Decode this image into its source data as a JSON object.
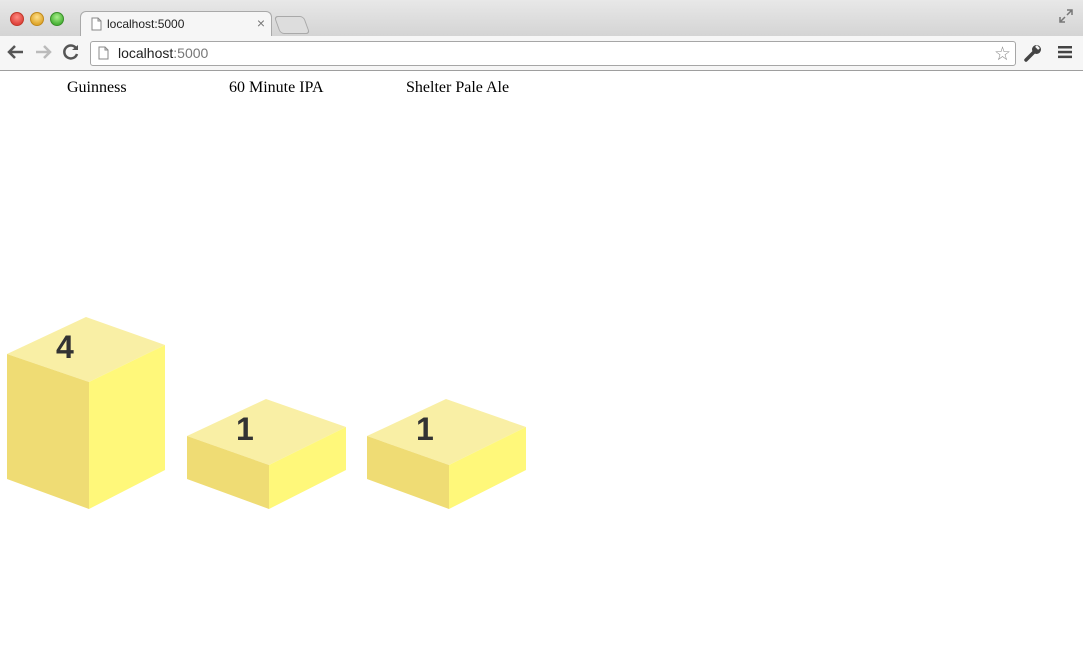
{
  "browser": {
    "tab_title": "localhost:5000",
    "tab_close": "×",
    "url_host": "localhost",
    "url_port": ":5000",
    "bookmark_star": "☆"
  },
  "beers": [
    {
      "name": "Guinness",
      "count": "4"
    },
    {
      "name": "60 Minute IPA",
      "count": "1"
    },
    {
      "name": "Shelter Pale Ale",
      "count": "1"
    }
  ],
  "colors": {
    "cube_top": "#f9efa5",
    "cube_left": "#efdc74",
    "cube_right": "#fff87a"
  }
}
